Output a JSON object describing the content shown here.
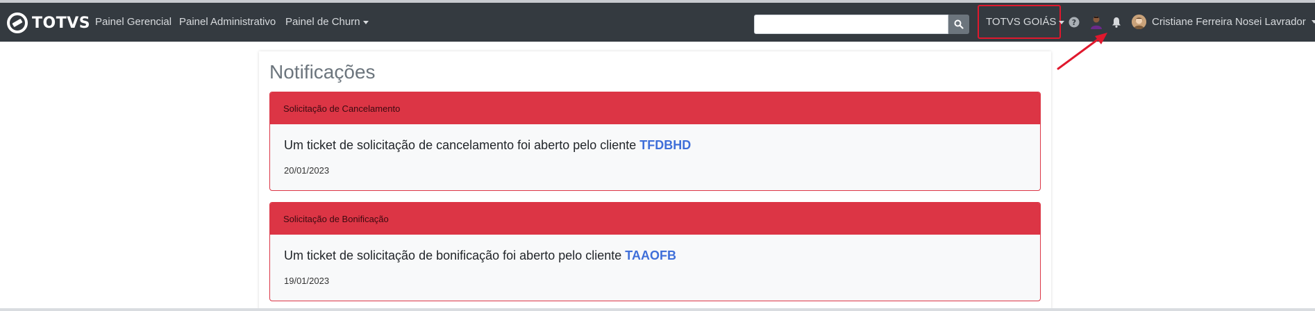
{
  "brand": {
    "name": "TOTVS"
  },
  "nav": {
    "items": [
      {
        "label": "Painel Gerencial"
      },
      {
        "label": "Painel Administrativo"
      },
      {
        "label": "Painel de Churn"
      }
    ]
  },
  "search": {
    "placeholder": "",
    "value": "",
    "icon": "search-icon"
  },
  "tenant": {
    "label": "TOTVS GOIÁS"
  },
  "user": {
    "name": "Cristiane Ferreira Nosei Lavrador"
  },
  "colors": {
    "navbar": "#343a40",
    "danger": "#dc3545",
    "link": "#3f6fd9",
    "highlight": "#e0182d"
  },
  "page": {
    "title": "Notificações"
  },
  "notifications": [
    {
      "header": "Solicitação de Cancelamento",
      "message": "Um ticket de solicitação de cancelamento foi aberto pelo cliente",
      "client": "TFDBHD",
      "date": "20/01/2023"
    },
    {
      "header": "Solicitação de Bonificação",
      "message": "Um ticket de solicitação de bonificação foi aberto pelo cliente",
      "client": "TAAOFB",
      "date": "19/01/2023"
    }
  ]
}
